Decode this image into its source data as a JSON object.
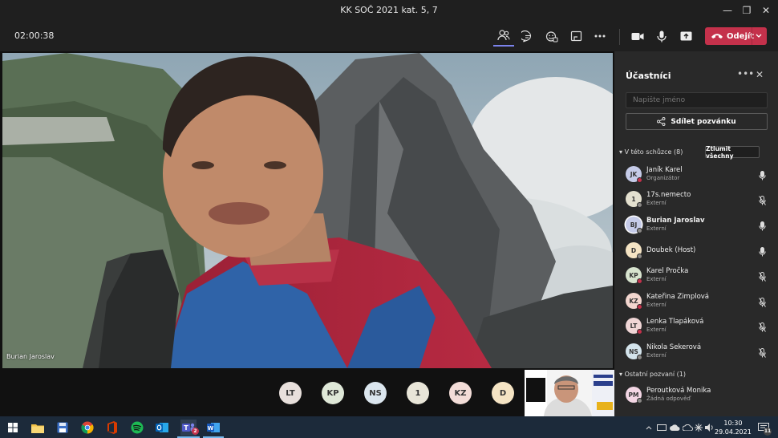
{
  "window": {
    "title": "KK SOČ 2021 kat. 5, 7"
  },
  "toolbar": {
    "timer": "02:00:38",
    "leave_label": "Odejít"
  },
  "stage": {
    "speaker_name": "Burian Jaroslav",
    "avatars": [
      {
        "initials": "LT",
        "color": "#e8e0dc"
      },
      {
        "initials": "KP",
        "color": "#dfe8d8"
      },
      {
        "initials": "NS",
        "color": "#dbe6ee"
      },
      {
        "initials": "1",
        "color": "#e8e5d8"
      },
      {
        "initials": "KZ",
        "color": "#f3ddd8"
      },
      {
        "initials": "D",
        "color": "#f5e4c4"
      }
    ]
  },
  "panel": {
    "title": "Účastníci",
    "search_placeholder": "Napište jméno",
    "share_label": "Sdílet pozvánku",
    "in_meeting_label": "V této schůzce (8)",
    "mute_all_label": "Ztlumit všechny",
    "others_label": "Ostatní pozvaní (1)",
    "participants": [
      {
        "initials": "JK",
        "name": "Janík Karel",
        "role": "Organizátor",
        "avatar_color": "#c5cbe8",
        "status_color": "#c4314b",
        "muted": false,
        "bold": false
      },
      {
        "initials": "1",
        "name": "17s.nemecto",
        "role": "Externí",
        "avatar_color": "#e3e0cf",
        "status_color": "#8a8886",
        "muted": true,
        "bold": false
      },
      {
        "initials": "BJ",
        "name": "Burian Jaroslav",
        "role": "Externí",
        "avatar_color": "#c5cbe8",
        "status_color": "#8a8886",
        "muted": false,
        "bold": true
      },
      {
        "initials": "D",
        "name": "Doubek (Host)",
        "role": "",
        "avatar_color": "#f5e4c4",
        "status_color": "#8a8886",
        "muted": false,
        "bold": false
      },
      {
        "initials": "KP",
        "name": "Karel Pročka",
        "role": "Externí",
        "avatar_color": "#d8e4cf",
        "status_color": "#c4314b",
        "muted": true,
        "bold": false
      },
      {
        "initials": "KZ",
        "name": "Kateřina Zimplová",
        "role": "Externí",
        "avatar_color": "#f3d6cf",
        "status_color": "#c4314b",
        "muted": true,
        "bold": false
      },
      {
        "initials": "LT",
        "name": "Lenka Tlapáková",
        "role": "Externí",
        "avatar_color": "#f0d6d6",
        "status_color": "#c4314b",
        "muted": true,
        "bold": false
      },
      {
        "initials": "NS",
        "name": "Nikola Sekerová",
        "role": "Externí",
        "avatar_color": "#d4e4ec",
        "status_color": "#8a8886",
        "muted": true,
        "bold": false
      }
    ],
    "invited": [
      {
        "initials": "PM",
        "name": "Peroutková Monika",
        "role": "Žádná odpověď",
        "avatar_color": "#f3d6e4",
        "status_color": "#8a8886"
      }
    ]
  },
  "taskbar": {
    "time": "10:30",
    "date": "29.04.2021",
    "notif_count": "11",
    "teams_badge": "2",
    "apps": [
      "start-icon",
      "explorer-icon",
      "save-icon",
      "chrome-icon",
      "office-icon",
      "spotify-icon",
      "outlook-icon",
      "teams-icon",
      "word-icon"
    ]
  }
}
